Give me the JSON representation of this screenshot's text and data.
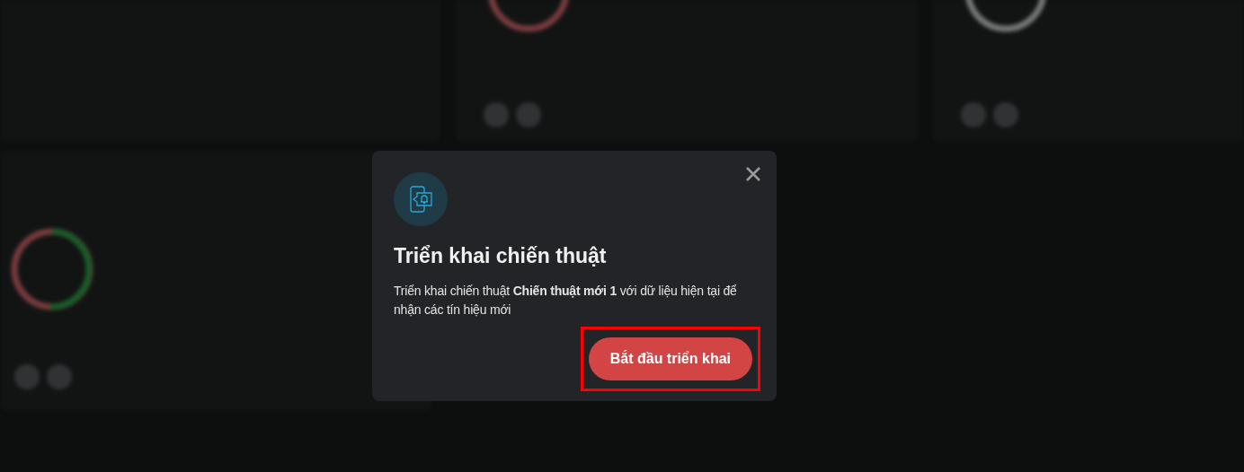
{
  "dialog": {
    "title": "Triển khai chiến thuật",
    "message": "Triển khai chiến thuật **Chiến thuật mới 1** với dữ liệu hiện tại để nhận các tín hiệu mới",
    "button": {
      "label": "Bắt đầu triển khai",
      "highlighted": true
    }
  }
}
